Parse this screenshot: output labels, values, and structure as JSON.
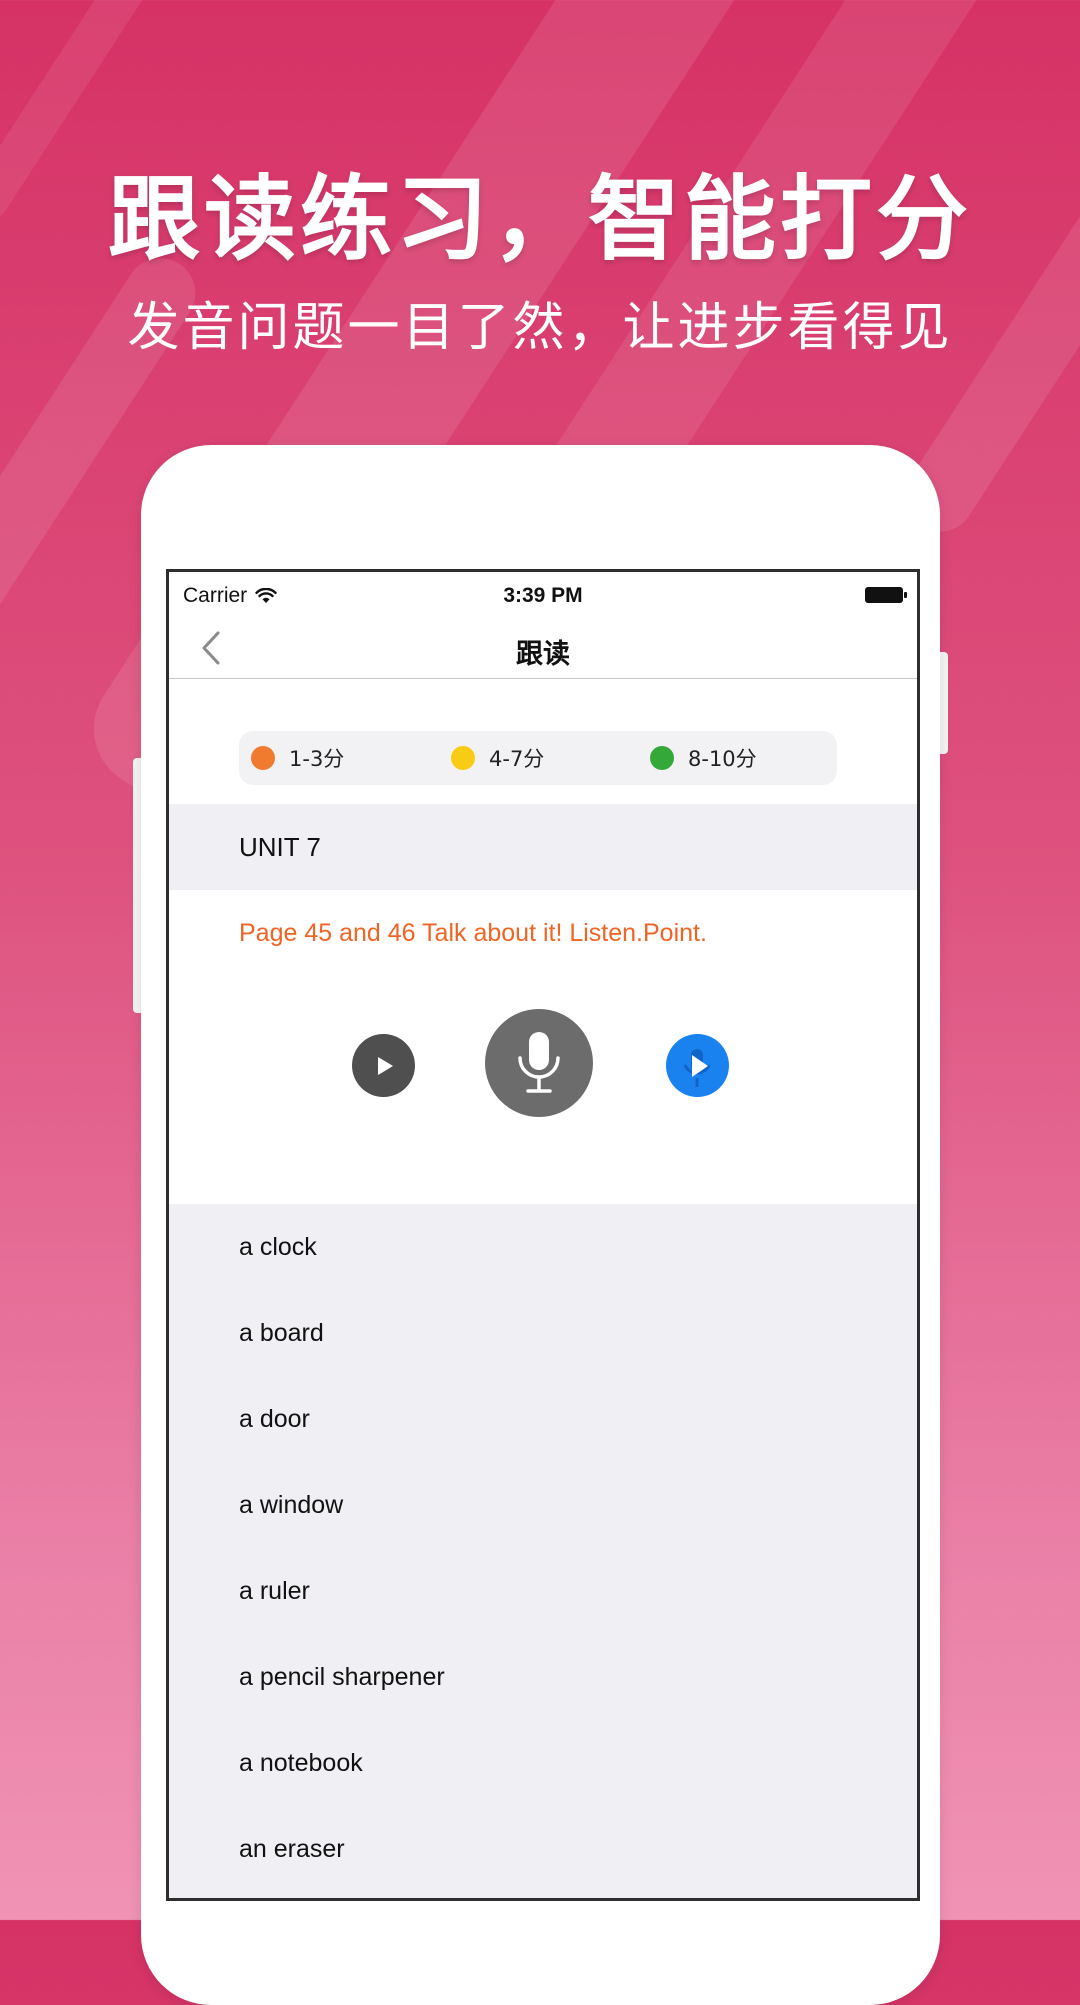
{
  "promo": {
    "headline": "跟读练习，智能打分",
    "subline": "发音问题一目了然，让进步看得见"
  },
  "status_bar": {
    "carrier": "Carrier",
    "time": "3:39 PM"
  },
  "nav": {
    "title": "跟读"
  },
  "legend": [
    {
      "label": "1-3分",
      "color": "#f07a2e"
    },
    {
      "label": "4-7分",
      "color": "#f8cc14"
    },
    {
      "label": "8-10分",
      "color": "#35a83a"
    }
  ],
  "unit": {
    "title": "UNIT 7"
  },
  "sentence": {
    "text": "Page 45 and 46 Talk about it! Listen.Point."
  },
  "words": [
    "a clock",
    "a board",
    "a door",
    "a window",
    "a ruler",
    "a pencil sharpener",
    "a notebook",
    "an eraser"
  ]
}
